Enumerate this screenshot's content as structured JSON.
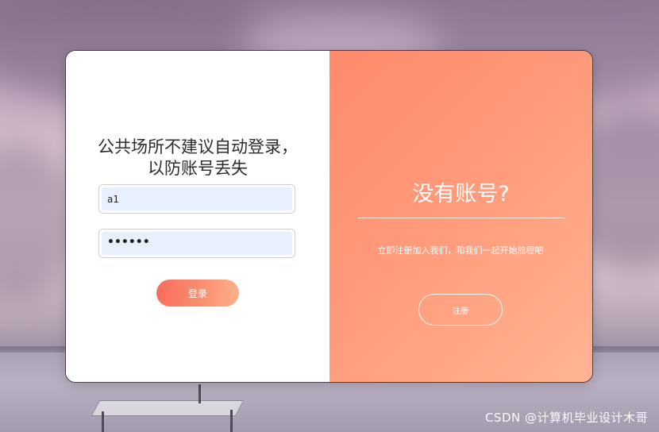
{
  "login": {
    "title_line1": "公共场所不建议自动登录，",
    "title_line2": "以防账号丢失",
    "username_value": "a1",
    "password_value": "••••••",
    "login_button": "登录"
  },
  "register_panel": {
    "title": "没有账号?",
    "message": "立即注册加入我们，和我们一起开始旅程吧",
    "register_button": "注册"
  },
  "watermark": "CSDN @计算机毕业设计木哥",
  "colors": {
    "accent_start": "#f86e5e",
    "accent_end": "#fdb18a",
    "panel_gradient_start": "#ff8a6c",
    "panel_gradient_end": "#ffb493",
    "input_fill": "#e8f0fe"
  }
}
